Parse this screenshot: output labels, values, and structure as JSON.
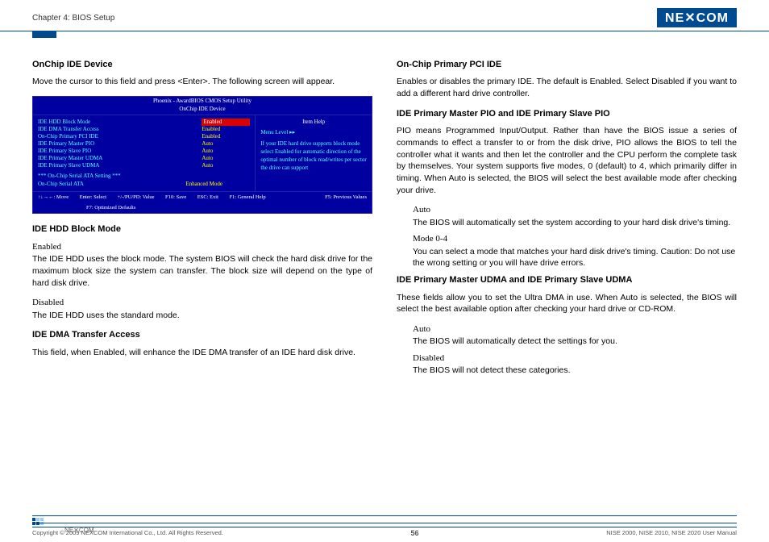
{
  "header": {
    "chapter": "Chapter 4: BIOS Setup",
    "logo": "NE✕COM"
  },
  "left": {
    "h1": "OnChip IDE Device",
    "p1": "Move the cursor to this field and press <Enter>. The following screen will appear.",
    "h2": "IDE HDD Block Mode",
    "opt1": "Enabled",
    "p2": "The IDE HDD uses the block mode. The system BIOS will check the hard disk drive for the maximum block size the system can transfer. The block size will depend on the type of hard disk drive.",
    "opt2": "Disabled",
    "p3": "The IDE HDD uses the standard mode.",
    "h3": "IDE DMA Transfer Access",
    "p4": "This field, when Enabled, will enhance the IDE DMA transfer of an IDE hard disk drive."
  },
  "bios": {
    "title1": "Phoenix - AwardBIOS CMOS Setup Utility",
    "title2": "OnChip IDE Device",
    "rows": [
      {
        "k": "IDE HDD Block Mode",
        "v": "Enabled",
        "sel": true
      },
      {
        "k": "IDE DMA Transfer Access",
        "v": "Enabled"
      },
      {
        "k": "On-Chip Primary PCI IDE",
        "v": "Enabled"
      },
      {
        "k": "IDE Primary Master PIO",
        "v": "Auto"
      },
      {
        "k": "IDE Primary Slave PIO",
        "v": "Auto"
      },
      {
        "k": "IDE Primary Master UDMA",
        "v": "Auto"
      },
      {
        "k": "IDE Primary Slave UDMA",
        "v": "Auto"
      }
    ],
    "sep": "*** On-Chip Serial ATA Setting ***",
    "row8": {
      "k": "On-Chip Serial ATA",
      "v": "Enhanced Mode"
    },
    "helpTitle": "Item Help",
    "menuLevel": "Menu Level    ▸▸",
    "helpText": "If your IDE hard drive supports block mode select Enabled for automatic direction of the optimal number of block read/writes per sector the drive can support",
    "keys": {
      "move": "↑↓→←: Move",
      "enter": "Enter: Select",
      "pupd": "+/-/PU/PD: Value",
      "f10": "F10: Save",
      "esc": "ESC: Exit",
      "f1": "F1: General Help",
      "f5": "F5: Previous Values",
      "f7": "F7: Optimized Defaults"
    }
  },
  "right": {
    "h1": "On-Chip Primary PCI IDE",
    "p1": "Enables or disables the primary IDE. The default is Enabled. Select Disabled if you want to add a different hard drive controller.",
    "h2": "IDE Primary Master PIO and IDE Primary Slave PIO",
    "p2": "PIO means Programmed Input/Output. Rather than have the BIOS issue a series of commands to effect a transfer to or from the disk drive, PIO allows the BIOS to tell the controller what it wants and then let the controller and the CPU perform the complete task by themselves. Your system supports five modes, 0 (default) to 4, which primarily differ in timing. When Auto is selected, the BIOS will select the best available mode after checking your drive.",
    "opt1": "Auto",
    "p3": "The BIOS will automatically set the system according to your hard disk drive's timing.",
    "opt2": "Mode 0-4",
    "p4": "You can select a mode that matches your hard disk drive's timing. Caution: Do not use the wrong setting or you will have drive errors.",
    "h3": "IDE Primary Master UDMA and IDE Primary Slave UDMA",
    "p5": "These fields allow you to set the Ultra DMA in use. When Auto is selected, the BIOS will select the best available option after checking your hard drive or CD-ROM.",
    "opt3": "Auto",
    "p6": "The BIOS will automatically detect the settings for you.",
    "opt4": "Disabled",
    "p7": "The BIOS will not detect these categories."
  },
  "footer": {
    "copyright": "Copyright © 2009 NEXCOM International Co., Ltd. All Rights Reserved.",
    "page": "56",
    "manual": "NISE 2000, NISE 2010, NISE 2020 User Manual",
    "logo": "NE✕COM"
  }
}
